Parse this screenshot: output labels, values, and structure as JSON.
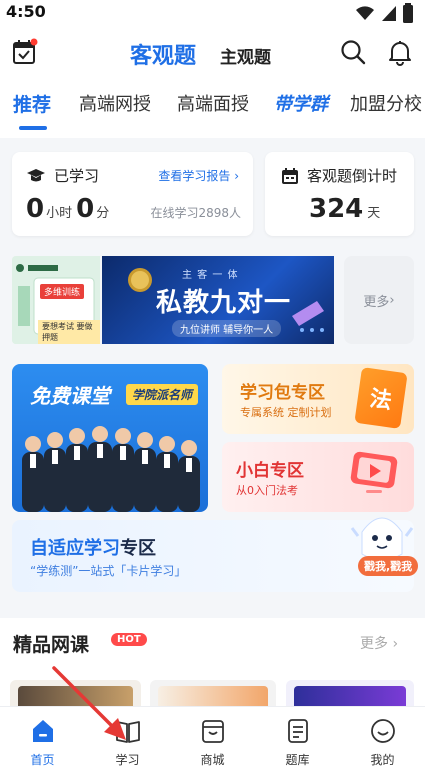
{
  "status_bar": {
    "time": "4:50"
  },
  "header": {
    "tabs": [
      {
        "label": "客观题",
        "active": true
      },
      {
        "label": "主观题",
        "active": false
      }
    ],
    "icons": [
      "calendar-icon",
      "search-icon",
      "bell-icon"
    ]
  },
  "nav_tabs": [
    {
      "label": "推荐",
      "active": true
    },
    {
      "label": "高端网授"
    },
    {
      "label": "高端面授"
    },
    {
      "label": "带学群",
      "emphasized": true
    },
    {
      "label": "加盟分校"
    }
  ],
  "study_card": {
    "title": "已学习",
    "report_link": "查看学习报告",
    "hours": "0",
    "hours_unit": "小时",
    "minutes": "0",
    "minutes_unit": "分",
    "online": "在线学习2898人"
  },
  "countdown_card": {
    "title": "客观题倒计时",
    "days": "324",
    "unit": "天"
  },
  "banner": {
    "left_tag": "多维训练",
    "left_note": "要想考试 要做押题",
    "main_tag": "主 客 一 体",
    "main_title": "私教九对一",
    "main_subtitle": "九位讲师 辅导你一人",
    "more": "更多"
  },
  "promos": {
    "free_course": {
      "title": "免费课堂",
      "badge": "学院派名师"
    },
    "package": {
      "title": "学习包专区",
      "subtitle": "专属系统  定制计划",
      "icon_char": "法"
    },
    "newbie": {
      "title": "小白专区",
      "subtitle": "从0入门法考"
    },
    "adaptive": {
      "title_blue": "自适应学习",
      "title_dark": "专区",
      "subtitle": "“学练测”一站式「卡片学习」",
      "bubble": "戳我,戳我"
    }
  },
  "section": {
    "title": "精品网课",
    "badge": "HOT",
    "more": "更多"
  },
  "tab_bar": [
    {
      "label": "首页",
      "icon": "home-icon",
      "active": true
    },
    {
      "label": "学习",
      "icon": "book-icon"
    },
    {
      "label": "商城",
      "icon": "store-icon"
    },
    {
      "label": "题库",
      "icon": "question-bank-icon"
    },
    {
      "label": "我的",
      "icon": "profile-icon"
    }
  ],
  "colors": {
    "accent": "#1f6fe6",
    "hot": "#ff4a4a",
    "orange": "#e07a10",
    "red": "#e13434"
  }
}
